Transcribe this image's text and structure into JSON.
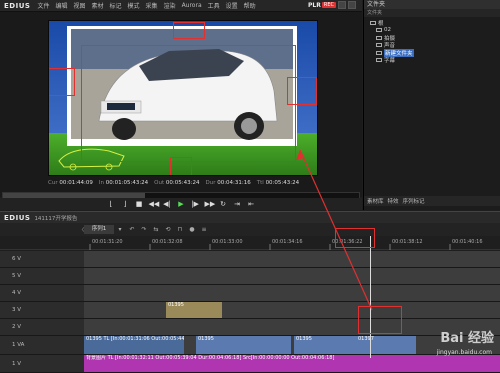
{
  "app": {
    "name": "EDIUS",
    "plr": "PLR",
    "rec": "REC"
  },
  "menu": [
    "文件",
    "编辑",
    "视图",
    "素材",
    "标记",
    "模式",
    "采集",
    "渲染",
    "Aurora",
    "工具",
    "设置",
    "帮助"
  ],
  "preview": {
    "timecodes": [
      {
        "label": "Cur",
        "value": "00:01:44:09"
      },
      {
        "label": "In",
        "value": "00:01:05:43:24"
      },
      {
        "label": "Out",
        "value": "00:05:43:24"
      },
      {
        "label": "Dur",
        "value": "00:04:31:16"
      },
      {
        "label": "Ttl",
        "value": "00:05:43:24"
      }
    ],
    "scrub_progress": 0.4
  },
  "bin": {
    "title": "文件夹",
    "subtitle": "文件夹",
    "root": "根",
    "folders": [
      "02",
      "拍摄",
      "声音",
      "新建文件夹",
      "字幕"
    ],
    "selected": 3,
    "tabs": [
      "素材库",
      "特效",
      "序列标记"
    ]
  },
  "timeline": {
    "title": "EDIUS",
    "project": "141117开学报告",
    "sequence_tab": "序列1",
    "ruler_labels": [
      "00:01:31:20",
      "00:01:32:08",
      "00:01:33:00",
      "00:01:34:16",
      "00:01:36:22",
      "00:01:38:12",
      "00:01:40:16"
    ],
    "tracks": [
      {
        "name": "6 V",
        "clips": []
      },
      {
        "name": "5 V",
        "clips": []
      },
      {
        "name": "4 V",
        "clips": []
      },
      {
        "name": "3 V",
        "clips": [
          {
            "label": "01395",
            "color": "#9a8a5a"
          }
        ]
      },
      {
        "name": "2 V",
        "clips": []
      },
      {
        "name": "1 VA",
        "clips": [
          {
            "label": "01395  TL [In:00:01:31:06 Out:00:05:44:00]",
            "color": "#4a6a9a"
          },
          {
            "label": "01395",
            "color": "#5a7ab0"
          },
          {
            "label": "01395",
            "color": "#5a7ab0"
          },
          {
            "label": "01397",
            "color": "#5a7ab0"
          }
        ]
      },
      {
        "name": "1 V",
        "clips": [
          {
            "label": "背景图片  TL [In:00:01:32:11 Out:00:05:39:04 Dur:00:04:06:18]  Src[In:00:00:00:00 Out:00:04:06:18]",
            "color": "#b035b0"
          }
        ]
      }
    ],
    "toolbar_icons": [
      "keyframe-icon",
      "cut-icon",
      "fx-icon",
      "marker-icon",
      "undo-icon",
      "redo-icon",
      "ripple-icon",
      "sync-icon",
      "snap-icon",
      "mic-icon",
      "mixer-icon"
    ]
  },
  "transport": [
    "mark-in-icon",
    "mark-out-icon",
    "stop-icon",
    "rewind-icon",
    "step-back-icon",
    "play-icon",
    "step-forward-icon",
    "fast-forward-icon",
    "loop-icon",
    "insert-icon",
    "overwrite-icon"
  ],
  "watermark": {
    "text": "Bai 经验",
    "url": "jingyan.baidu.com"
  }
}
